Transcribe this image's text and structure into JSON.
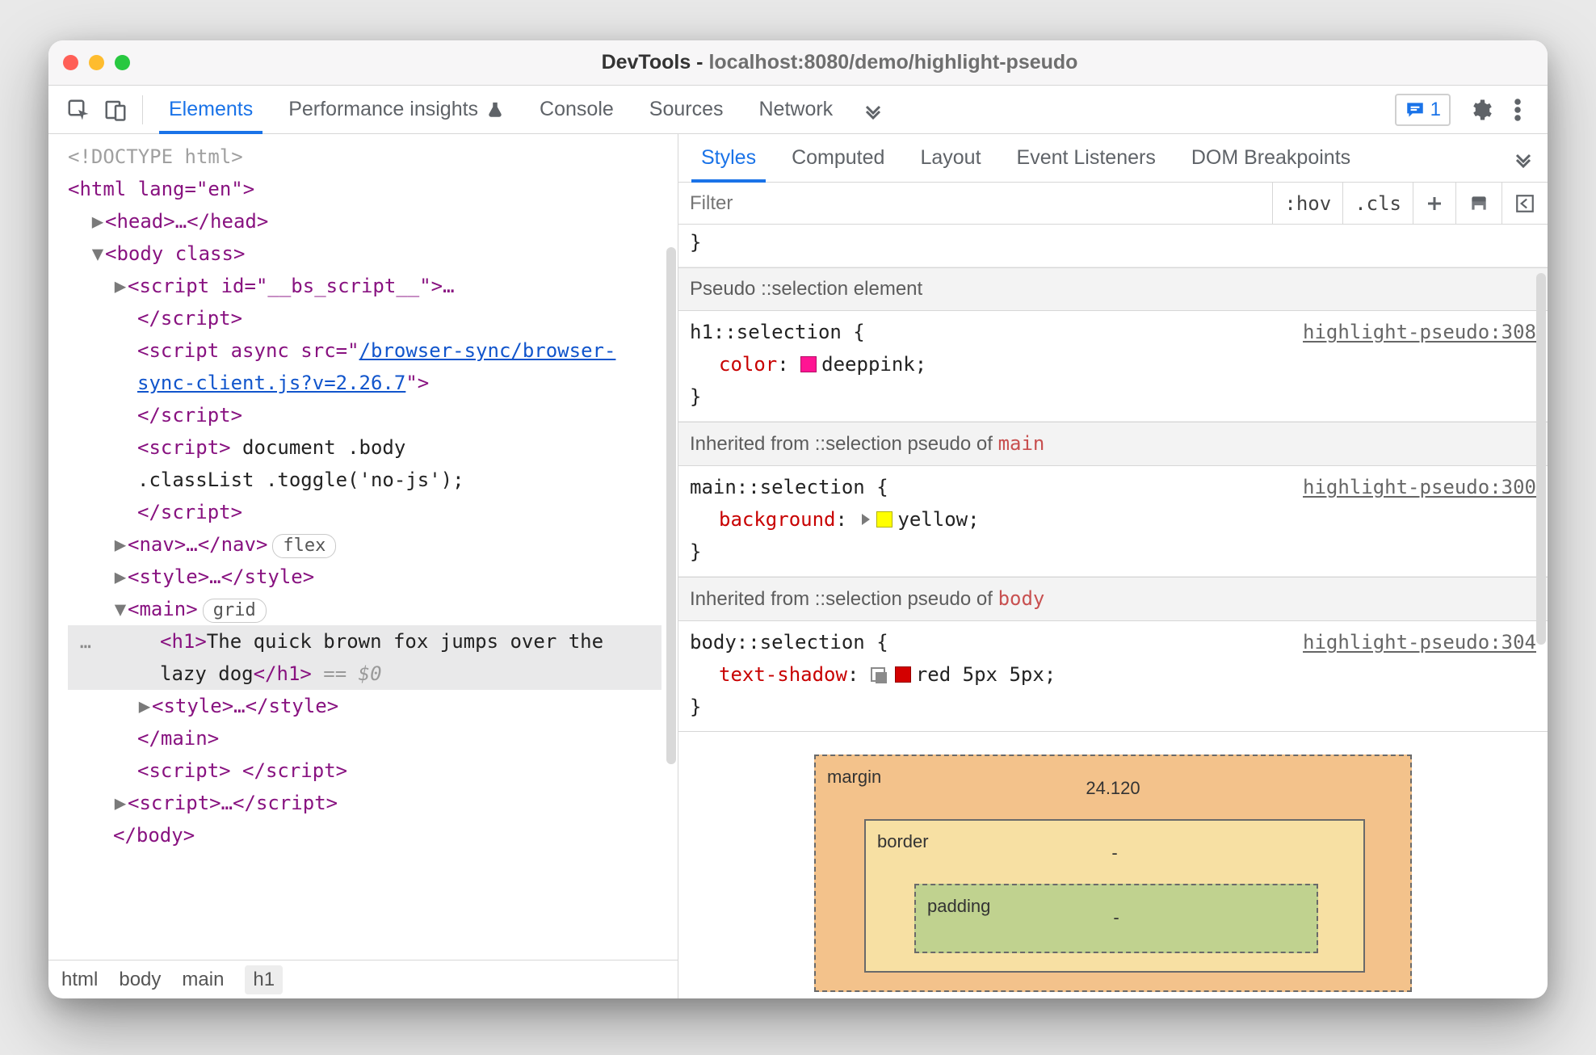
{
  "window": {
    "title_prefix": "DevTools - ",
    "title_url": "localhost:8080/demo/highlight-pseudo"
  },
  "tabs": {
    "elements": "Elements",
    "perf": "Performance insights",
    "console": "Console",
    "sources": "Sources",
    "network": "Network"
  },
  "badge_count": "1",
  "breadcrumb": [
    "html",
    "body",
    "main",
    "h1"
  ],
  "right_tabs": {
    "styles": "Styles",
    "computed": "Computed",
    "layout": "Layout",
    "listeners": "Event Listeners",
    "dombp": "DOM Breakpoints"
  },
  "filter": {
    "placeholder": "Filter",
    "hov": ":hov",
    "cls": ".cls"
  },
  "dom": {
    "doctype": "<!DOCTYPE html>",
    "html_open": "<html lang=\"en\">",
    "head": "<head>…</head>",
    "body_open": "<body class>",
    "script_bs": "<script id=\"__bs_script__\">…",
    "close_script": "</script>",
    "async_open": "<script async src=\"",
    "async_link": "/browser-sync/browser-sync-client.js?v=2.26.7",
    "async_close": "\">",
    "inline_open": "<script>",
    "inline_body1": " document .body",
    "inline_body2": ".classList .toggle('no-js');",
    "nav": "<nav>…</nav>",
    "nav_badge": "flex",
    "style": "<style>…</style>",
    "main_open": "<main>",
    "main_badge": "grid",
    "h1_open": "<h1>",
    "h1_text": "The quick brown fox jumps over the lazy dog",
    "h1_close": "</h1>",
    "eq": " == ",
    "dollar": "$0",
    "style2": "<style>…</style>",
    "main_close": "</main>",
    "script_empty": "<script> </script>",
    "script_dots": "<script>…</script>",
    "body_close": "</body>"
  },
  "styles": {
    "cutoff": "}",
    "sec1": "Pseudo ::selection element",
    "rule1": {
      "sel": "h1::selection {",
      "src": "highlight-pseudo:308",
      "prop": "color",
      "val": "deeppink",
      "swatch": "#ff1493"
    },
    "sec2_a": "Inherited from ::selection pseudo of ",
    "sec2_b": "main",
    "rule2": {
      "sel": "main::selection {",
      "src": "highlight-pseudo:300",
      "prop": "background",
      "val": "yellow",
      "swatch": "#ffff00"
    },
    "sec3_a": "Inherited from ::selection pseudo of ",
    "sec3_b": "body",
    "rule3": {
      "sel": "body::selection {",
      "src": "highlight-pseudo:304",
      "prop": "text-shadow",
      "val": "red 5px 5px",
      "swatch": "#d30000"
    },
    "close": "}"
  },
  "boxmodel": {
    "margin_label": "margin",
    "margin_top": "24.120",
    "border_label": "border",
    "border_top": "-",
    "padding_label": "padding",
    "padding_top": "-"
  }
}
